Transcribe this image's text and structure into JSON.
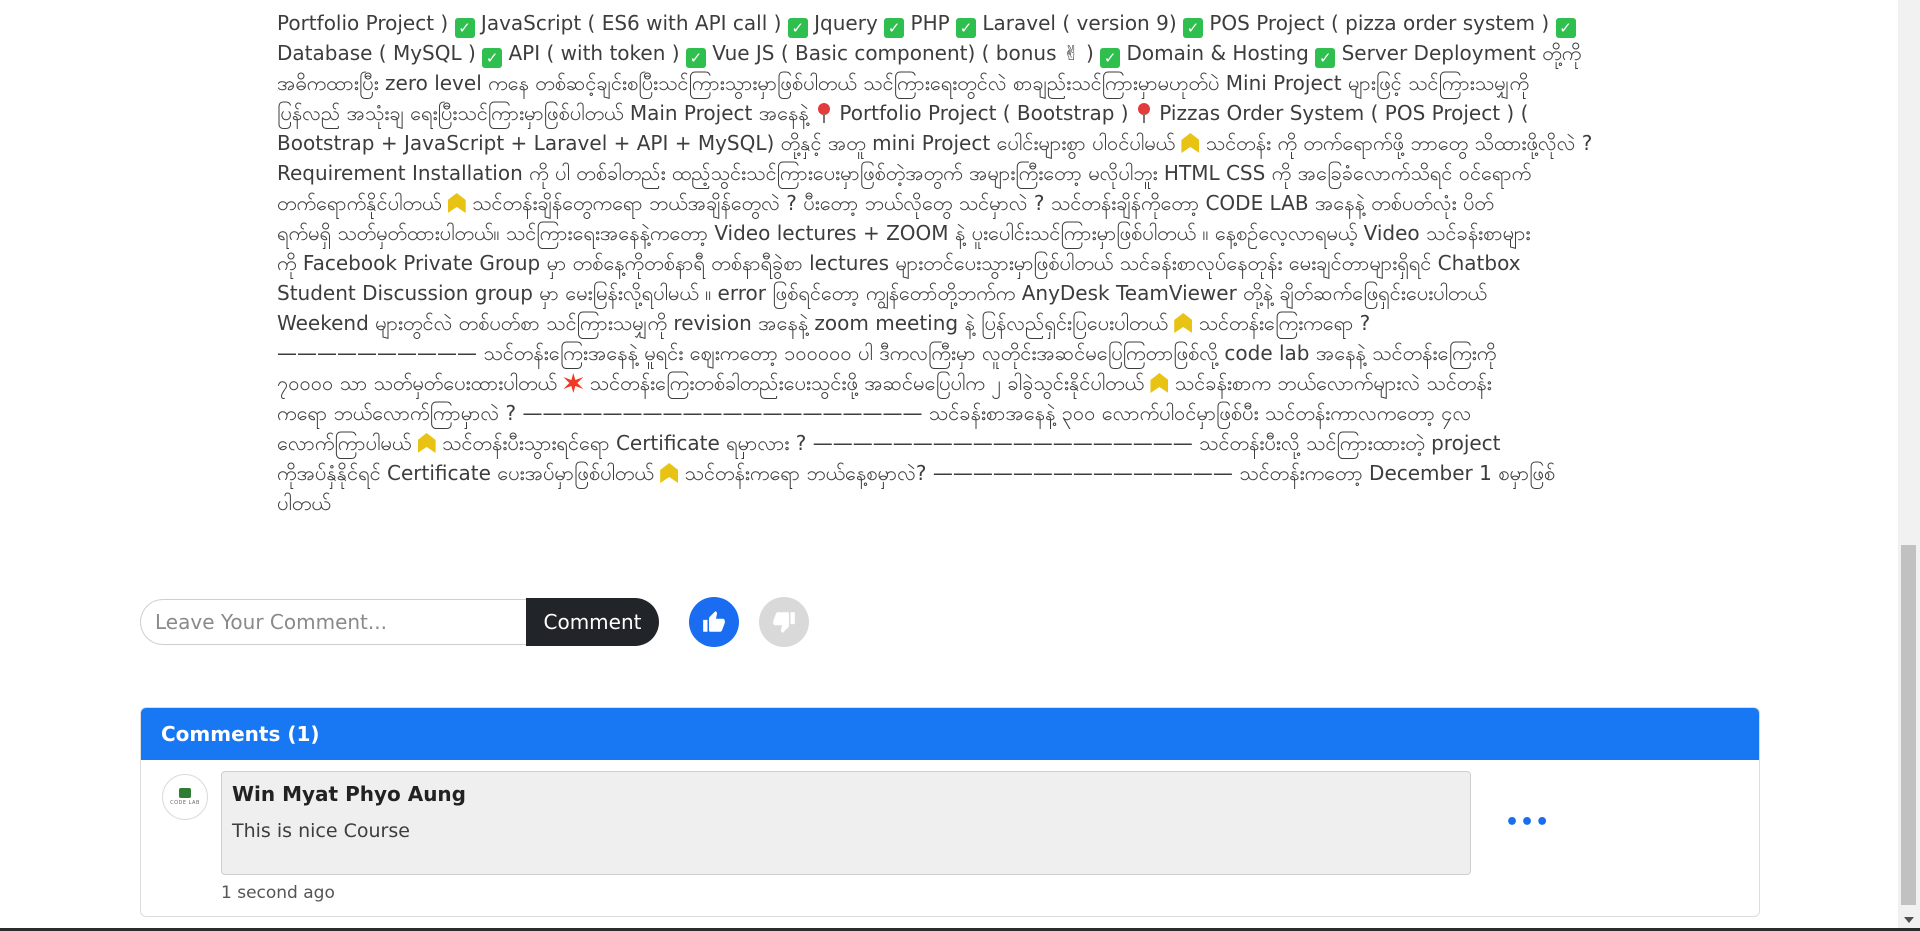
{
  "description": {
    "lines": [
      "Portfolio Project ) ✅ JavaScript ( ES6 with API call ) ✅ Jquery ✅ PHP ✅ Laravel ( version 9) ✅ POS Project ( pizza order system ) ✅",
      "Database ( MySQL ) ✅ API ( with token ) ✅ Vue JS ( Basic component) ( bonus ✌ ) ✅ Domain & Hosting ✅ Server Deployment တို့ကို",
      "အဓိကထားပြီး zero level ကနေ တစ်ဆင့်ချင်းစပြီးသင်ကြားသွားမှာဖြစ်ပါတယ် သင်ကြားရေးတွင်လဲ စာချည်းသင်ကြားမှာမဟုတ်ပဲ Mini Project များဖြင့် သင်ကြားသမျှကို",
      "ပြန်လည် အသုံးချ ရေးပြီးသင်ကြားမှာဖြစ်ပါတယ် Main Project အနေနဲ့ 📌 Portfolio Project ( Bootstrap ) 📌 Pizzas Order System ( POS Project ) (",
      "Bootstrap + JavaScript + Laravel + API + MySQL) တို့နှင့် အတူ mini Project ပေါင်းများစွာ ပါဝင်ပါမယ် 🔰 သင်တန်း ကို တက်ရောက်ဖို့ ဘာတွေ သိထားဖို့လိုလဲ ?",
      "Requirement Installation ကို ပါ တစ်ခါတည်း ထည့်သွင်းသင်ကြားပေးမှာဖြစ်တဲ့အတွက် အများကြီးတော့ မလိုပါဘူး HTML CSS ကို အခြေခံလောက်သိရင် ဝင်ရောက်",
      "တက်ရောက်နိုင်ပါတယ် 🔰 သင်တန်းချိန်တွေကရော ဘယ်အချိန်တွေလဲ ? ပီးတော့ ဘယ်လိုတွေ သင်မှာလဲ ? သင်တန်းချိန်ကိုတော့ CODE LAB အနေနဲ့ တစ်ပတ်လုံး ပိတ်",
      "ရက်မရှိ သတ်မှတ်ထားပါတယ်။ သင်ကြားရေးအနေနဲ့ကတော့ Video lectures + ZOOM နဲ့ ပူးပေါင်းသင်ကြားမှာဖြစ်ပါတယ် ။ နေ့စဉ်လေ့လာရမယ့် Video သင်ခန်းစာများ",
      "ကို Facebook Private Group မှာ တစ်နေ့ကိုတစ်နာရီ တစ်နာရီခွဲစာ lectures များတင်ပေးသွားမှာဖြစ်ပါတယ် သင်ခန်းစာလုပ်နေတုန်း မေးချင်တာများရှိရင် Chatbox",
      "Student Discussion group မှာ မေးမြန်းလို့ရပါမယ် ။ error ဖြစ်ရင်တော့ ကျွန်တော်တို့ဘက်က AnyDesk TeamViewer တို့နဲ့ ချိတ်ဆက်ဖြေရှင်းပေးပါတယ်",
      "Weekend များတွင်လဲ တစ်ပတ်စာ သင်ကြားသမျှကို revision အနေနဲ့ zoom meeting နဲ့ ပြန်လည်ရှင်းပြပေးပါတယ် 🔰 သင်တန်းကြေးကရော ?",
      "—————————— သင်တန်းကြေးအနေနဲ့ မူရင်း ဈေးကတော့ ၁၀၀၀၀၀ ပါ ဒီကလကြီးမှာ လူတိုင်းအဆင်မပြေကြတာဖြစ်လို့ code lab အနေနဲ့ သင်တန်းကြေးကို",
      "၇၀၀၀၀ သာ သတ်မှတ်ပေးထားပါတယ် 💥 သင်တန်းကြေးတစ်ခါတည်းပေးသွင်းဖို့ အဆင်မပြေပါက ၂ ခါခွဲသွင်းနိုင်ပါတယ် 🔰 သင်ခန်းစာက ဘယ်လောက်များလဲ သင်တန်း",
      "ကရော ဘယ်လောက်ကြာမှာလဲ ? ———————————————————— သင်ခန်းစာအနေနဲ့ ၃၀၀ လောက်ပါဝင်မှာဖြစ်ပီး သင်တန်းကာလကတော့ ၄လ",
      "လောက်ကြာပါမယ် 🔰 သင်တန်းပီးသွားရင်ရော Certificate ရမှာလား ? ——————————————————— သင်တန်းပီးလို့ သင်ကြားထားတဲ့ project",
      "ကိုအပ်နှံနိုင်ရင် Certificate ပေးအပ်မှာဖြစ်ပါတယ် 🔰 သင်တန်းကရော ဘယ်နေ့စမှာလဲ? ——————————————— သင်တန်းကတော့ December 1 စမှာဖြစ်",
      "ပါတယ်"
    ]
  },
  "comment_form": {
    "placeholder": "Leave Your Comment...",
    "button_label": "Comment"
  },
  "reactions": {
    "like_icon": "thumbs-up-icon",
    "dislike_icon": "thumbs-down-icon",
    "like_color": "#1a6cf0",
    "dislike_color": "#d9d9d9"
  },
  "comments": {
    "header": "Comments (1)",
    "header_color": "#1877f2",
    "items": [
      {
        "author": "Win Myat Phyo Aung",
        "text": "This is nice Course",
        "time": "1 second ago",
        "menu_label": "•••"
      }
    ]
  },
  "avatar": {
    "logo_text": "CODE LAB"
  }
}
